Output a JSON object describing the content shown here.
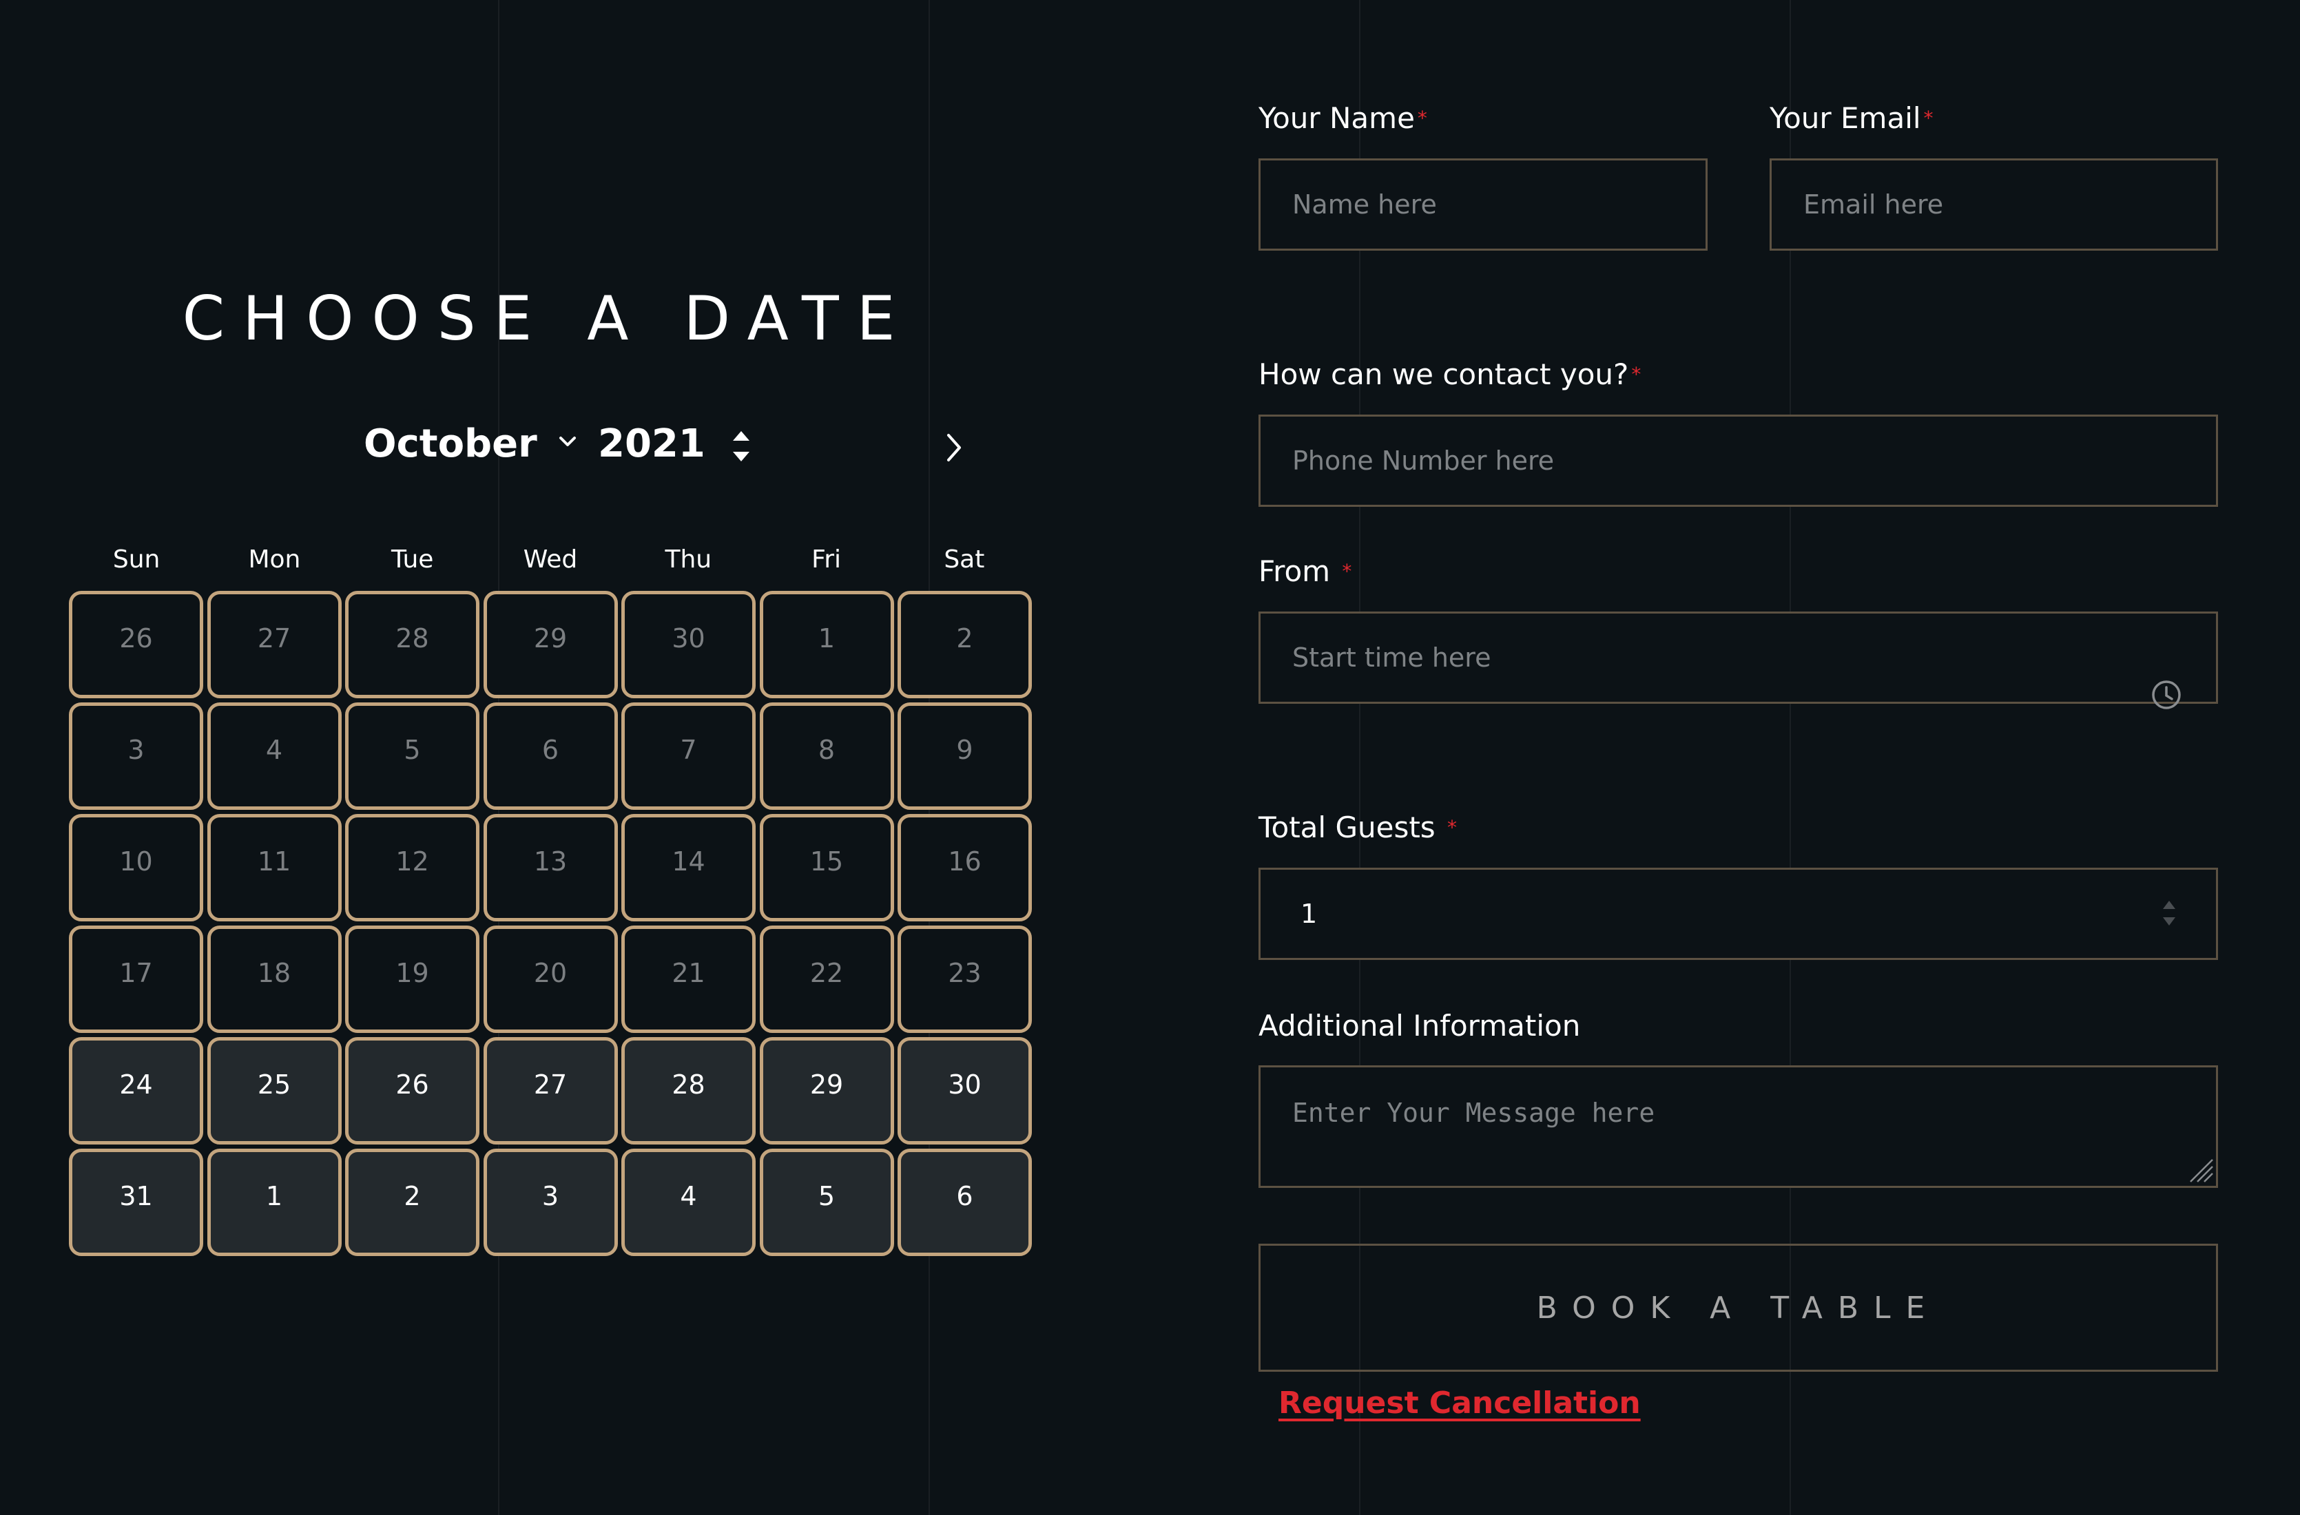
{
  "calendar": {
    "title": "CHOOSE A DATE",
    "month": "October",
    "year": "2021",
    "weekdays": [
      "Sun",
      "Mon",
      "Tue",
      "Wed",
      "Thu",
      "Fri",
      "Sat"
    ],
    "days": [
      {
        "label": "26",
        "active": false
      },
      {
        "label": "27",
        "active": false
      },
      {
        "label": "28",
        "active": false
      },
      {
        "label": "29",
        "active": false
      },
      {
        "label": "30",
        "active": false
      },
      {
        "label": "1",
        "active": false
      },
      {
        "label": "2",
        "active": false
      },
      {
        "label": "3",
        "active": false
      },
      {
        "label": "4",
        "active": false
      },
      {
        "label": "5",
        "active": false
      },
      {
        "label": "6",
        "active": false
      },
      {
        "label": "7",
        "active": false
      },
      {
        "label": "8",
        "active": false
      },
      {
        "label": "9",
        "active": false
      },
      {
        "label": "10",
        "active": false
      },
      {
        "label": "11",
        "active": false
      },
      {
        "label": "12",
        "active": false
      },
      {
        "label": "13",
        "active": false
      },
      {
        "label": "14",
        "active": false
      },
      {
        "label": "15",
        "active": false
      },
      {
        "label": "16",
        "active": false
      },
      {
        "label": "17",
        "active": false
      },
      {
        "label": "18",
        "active": false
      },
      {
        "label": "19",
        "active": false
      },
      {
        "label": "20",
        "active": false
      },
      {
        "label": "21",
        "active": false
      },
      {
        "label": "22",
        "active": false
      },
      {
        "label": "23",
        "active": false
      },
      {
        "label": "24",
        "active": true
      },
      {
        "label": "25",
        "active": true
      },
      {
        "label": "26",
        "active": true
      },
      {
        "label": "27",
        "active": true
      },
      {
        "label": "28",
        "active": true
      },
      {
        "label": "29",
        "active": true
      },
      {
        "label": "30",
        "active": true
      },
      {
        "label": "31",
        "active": true
      },
      {
        "label": "1",
        "active": true
      },
      {
        "label": "2",
        "active": true
      },
      {
        "label": "3",
        "active": true
      },
      {
        "label": "4",
        "active": true
      },
      {
        "label": "5",
        "active": true
      },
      {
        "label": "6",
        "active": true
      }
    ],
    "icons": {
      "month_caret": "chevron-down-icon",
      "year_stepper": "up-down-stepper-icon",
      "next": "chevron-right-icon"
    }
  },
  "form": {
    "name_label": "Your Name",
    "name_placeholder": "Name here",
    "email_label": "Your Email",
    "email_placeholder": "Email here",
    "contact_label": "How can we contact you?",
    "phone_placeholder": "Phone Number here",
    "from_label": "From",
    "from_placeholder": "Start time here",
    "guests_label": "Total Guests",
    "guests_value": "1",
    "info_label": "Additional Information",
    "info_placeholder": "Enter Your Message here",
    "required_mark": "*",
    "submit_label": "BOOK A TABLE",
    "cancel_label": "Request Cancellation"
  },
  "colors": {
    "background": "#0c1216",
    "day_border": "#c4a57e",
    "field_border": "#5c5142",
    "active_day_bg": "#23292d",
    "required": "#e0282f",
    "link": "#e0282f"
  }
}
